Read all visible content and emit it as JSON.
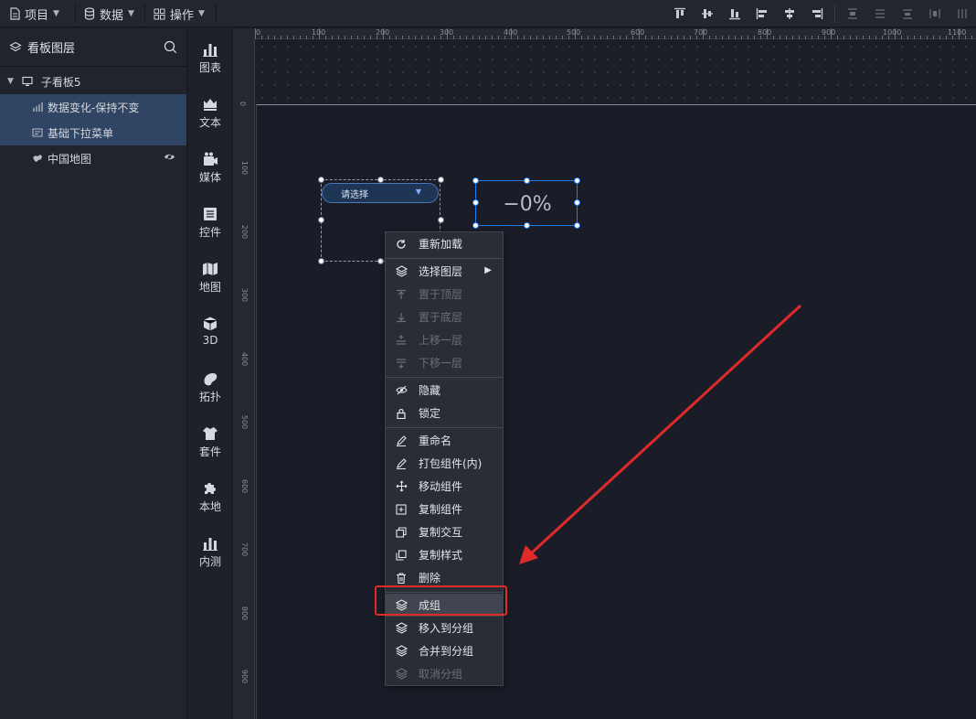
{
  "topbar": {
    "menus": [
      {
        "label": "项目",
        "icon": "document-icon"
      },
      {
        "label": "数据",
        "icon": "database-icon"
      },
      {
        "label": "操作",
        "icon": "grid-icon"
      }
    ]
  },
  "layer_panel": {
    "title": "看板图层",
    "board": "子看板5",
    "items": [
      {
        "label": "数据变化-保持不变",
        "icon": "bar-chart-icon",
        "selected": true
      },
      {
        "label": "基础下拉菜单",
        "icon": "dropdown-widget-icon",
        "selected": true
      },
      {
        "label": "中国地图",
        "icon": "map-icon",
        "selected": false,
        "hidden": true
      }
    ]
  },
  "components": [
    {
      "label": "图表",
      "icon": "chart-icon"
    },
    {
      "label": "文本",
      "icon": "text-icon"
    },
    {
      "label": "媒体",
      "icon": "media-icon"
    },
    {
      "label": "控件",
      "icon": "control-icon"
    },
    {
      "label": "地图",
      "icon": "map-icon"
    },
    {
      "label": "3D",
      "icon": "cube-icon"
    },
    {
      "label": "拓扑",
      "icon": "topology-icon"
    },
    {
      "label": "套件",
      "icon": "kit-icon"
    },
    {
      "label": "本地",
      "icon": "puzzle-icon"
    },
    {
      "label": "内测",
      "icon": "beta-chart-icon"
    }
  ],
  "ruler": {
    "top_labels": [
      "0",
      "100",
      "200",
      "300",
      "400",
      "500",
      "600",
      "700",
      "800",
      "900",
      "1000",
      "1100"
    ],
    "left_labels": [
      "0",
      "100",
      "200",
      "300",
      "400",
      "500",
      "600",
      "700",
      "800",
      "900"
    ]
  },
  "canvas": {
    "dropdown_placeholder": "请选择",
    "percent_value": "−0%"
  },
  "context_menu": {
    "items": [
      {
        "label": "重新加载",
        "icon": "reload-icon",
        "disabled": false
      },
      {
        "label": "选择图层",
        "icon": "layers-icon",
        "disabled": false,
        "submenu": true
      },
      {
        "label": "置于顶层",
        "icon": "bring-to-top-icon",
        "disabled": true
      },
      {
        "label": "置于底层",
        "icon": "send-to-bottom-icon",
        "disabled": true
      },
      {
        "label": "上移一层",
        "icon": "move-up-icon",
        "disabled": true
      },
      {
        "label": "下移一层",
        "icon": "move-down-icon",
        "disabled": true
      },
      {
        "label": "隐藏",
        "icon": "eye-off-icon",
        "disabled": false
      },
      {
        "label": "锁定",
        "icon": "lock-icon",
        "disabled": false
      },
      {
        "label": "重命名",
        "icon": "pencil-icon",
        "disabled": false
      },
      {
        "label": "打包组件(内)",
        "icon": "pencil-icon",
        "disabled": false
      },
      {
        "label": "移动组件",
        "icon": "move-icon",
        "disabled": false
      },
      {
        "label": "复制组件",
        "icon": "copy-component-icon",
        "disabled": false
      },
      {
        "label": "复制交互",
        "icon": "copy-icon",
        "disabled": false
      },
      {
        "label": "复制样式",
        "icon": "copy-icon",
        "disabled": false
      },
      {
        "label": "删除",
        "icon": "trash-icon",
        "disabled": false
      },
      {
        "label": "成组",
        "icon": "layers-icon",
        "disabled": false,
        "highlighted": true
      },
      {
        "label": "移入到分组",
        "icon": "layers-icon",
        "disabled": false
      },
      {
        "label": "合并到分组",
        "icon": "layers-icon",
        "disabled": false
      },
      {
        "label": "取消分组",
        "icon": "layers-icon",
        "disabled": true
      }
    ]
  },
  "colors": {
    "accent": "#1f7cf0",
    "selection_bg": "#2f4563",
    "annotation": "#e02a2a"
  }
}
